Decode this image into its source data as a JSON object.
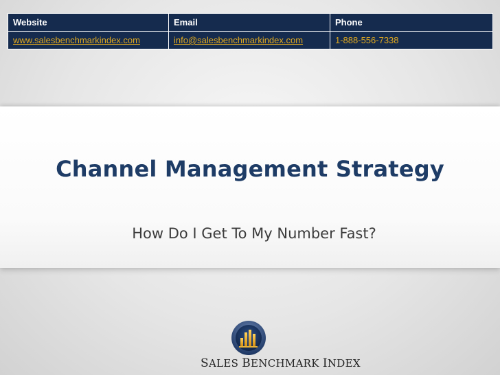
{
  "contact": {
    "headers": [
      "Website",
      "Email",
      "Phone"
    ],
    "website": "www.salesbenchmarkindex.com",
    "email": "info@salesbenchmarkindex.com",
    "phone": "1-888-556-7338"
  },
  "slide": {
    "title": "Channel Management Strategy",
    "subtitle": "How Do I Get To My Number Fast?"
  },
  "logo": {
    "initial_s": "S",
    "word_ales": "ALES ",
    "initial_b": "B",
    "word_enchmark": "ENCHMARK ",
    "initial_i": "I",
    "word_ndex": "NDEX"
  },
  "colors": {
    "navy": "#152b4e",
    "gold": "#e1a91f",
    "title_blue": "#1e3c66"
  }
}
